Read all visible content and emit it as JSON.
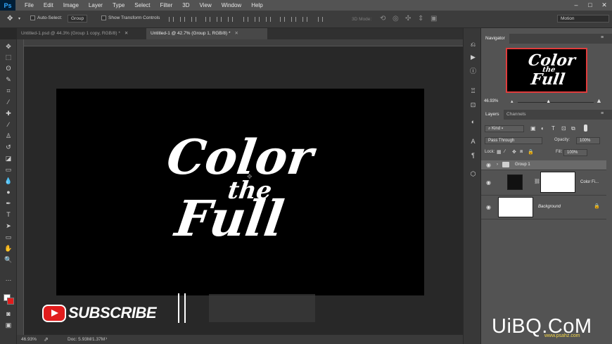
{
  "menu": {
    "logo": "Ps",
    "items": [
      "File",
      "Edit",
      "Image",
      "Layer",
      "Type",
      "Select",
      "Filter",
      "3D",
      "View",
      "Window",
      "Help"
    ],
    "window_controls": [
      "–",
      "□",
      "✕"
    ]
  },
  "options_bar": {
    "auto_select_label": "Auto-Select:",
    "auto_select_value": "Group",
    "show_transform_label": "Show Transform Controls",
    "mode_3d_label": "3D Mode:",
    "workspace_value": "Motion"
  },
  "tabs": [
    {
      "label": "Untitled-1.psd @ 44.3% (Group 1 copy, RGB/8) *",
      "active": false
    },
    {
      "label": "Untitled-1 @ 42.7% (Group 1, RGB/8) *",
      "active": true
    }
  ],
  "canvas_art": {
    "line1": "Color",
    "line2": "the",
    "line3": "Full"
  },
  "overlay": {
    "subscribe": "SUBSCRIBE"
  },
  "status": {
    "zoom": "46.93%",
    "doc": "Doc: 5.93M/1.37M"
  },
  "navigator": {
    "tab": "Navigator",
    "thumb_line1": "Color",
    "thumb_line2": "the",
    "thumb_line3": "Full",
    "zoom": "46.93%",
    "zoom_slider": 0.4
  },
  "layers": {
    "tabs": [
      "Layers",
      "Channels"
    ],
    "filter_kind": "Kind",
    "blend_mode": "Pass Through",
    "opacity_label": "Opacity:",
    "opacity_value": "100%",
    "lock_label": "Lock:",
    "fill_label": "Fill:",
    "fill_value": "100%",
    "rows": [
      {
        "name": "Group 1",
        "type": "group"
      },
      {
        "name": "Color Fi...",
        "type": "fill"
      },
      {
        "name": "Background",
        "type": "background"
      }
    ]
  },
  "watermark": {
    "text": "UiBQ.CoM",
    "sub": "www.psahz.com"
  },
  "colors": {
    "accent_red": "#e11d1d",
    "navigator_frame": "#e03c3c"
  }
}
